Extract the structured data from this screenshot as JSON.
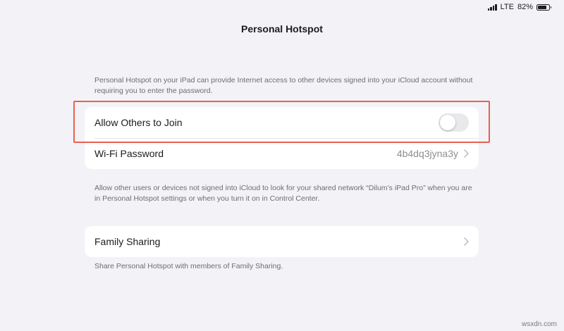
{
  "status_bar": {
    "network": "LTE",
    "battery_percent": "82%",
    "battery_level": 0.82
  },
  "header": {
    "title": "Personal Hotspot"
  },
  "intro_footnote": "Personal Hotspot on your iPad can provide Internet access to other devices signed into your iCloud account without requiring you to enter the password.",
  "hotspot_group": {
    "allow_others": {
      "label": "Allow Others to Join",
      "enabled": false
    },
    "wifi_password": {
      "label": "Wi-Fi Password",
      "value": "4b4dq3jyna3y"
    },
    "footnote": "Allow other users or devices not signed into iCloud to look for your shared network “Dilum’s iPad Pro” when you are in Personal Hotspot settings or when you turn it on in Control Center."
  },
  "family_group": {
    "family_sharing": {
      "label": "Family Sharing"
    },
    "footnote": "Share Personal Hotspot with members of Family Sharing."
  },
  "watermark": "wsxdn.com",
  "colors": {
    "background": "#f2f2f7",
    "card": "#ffffff",
    "toggle_off": "#e9e9eb",
    "toggle_on": "#34c759",
    "highlight": "#e8614f",
    "secondary_text": "#8e8e93"
  },
  "icons": {
    "signal": "cellular-signal-icon",
    "battery": "battery-icon",
    "chevron": "chevron-right-icon"
  }
}
